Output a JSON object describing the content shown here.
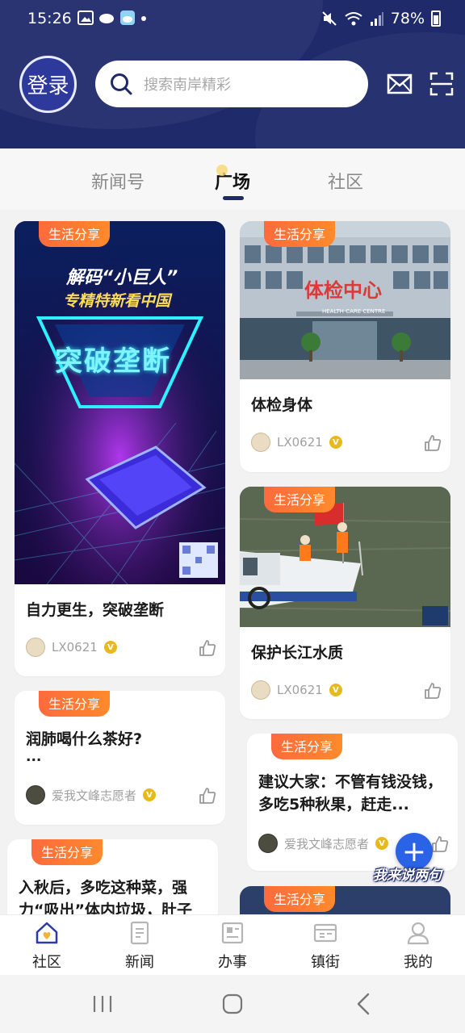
{
  "status_bar": {
    "time": "15:26",
    "battery": "78%"
  },
  "header": {
    "login_label": "登录",
    "search_placeholder": "搜索南岸精彩",
    "mail_icon": "mail-icon",
    "scan_icon": "scan-icon"
  },
  "tabs": [
    {
      "label": "新闻号",
      "active": false
    },
    {
      "label": "广场",
      "active": true
    },
    {
      "label": "社区",
      "active": false
    }
  ],
  "feed": {
    "cards": [
      {
        "tag": "生活分享",
        "title": "自力更生，突破垄断",
        "author": "LX0621",
        "image_text": [
          "解码“小巨人”",
          "专精特新看中国",
          "突破垄断"
        ]
      },
      {
        "tag": "生活分享",
        "title": "体检身体",
        "author": "LX0621",
        "image_text": [
          "体检中心",
          "HEALTH CARE CENTRE"
        ]
      },
      {
        "tag": "生活分享",
        "title": "保护长江水质",
        "author": "LX0621"
      },
      {
        "tag": "生活分享",
        "title": "润肺喝什么茶好?",
        "excerpt": "...",
        "author": "爱我文峰志愿者"
      },
      {
        "tag": "生活分享",
        "title": "建议大家：不管有钱没钱，多吃5种秋果，赶走...",
        "author": "爱我文峰志愿者"
      },
      {
        "tag": "生活分享",
        "title": "入秋后，多吃这种菜，强力“吸出”体内垃圾，肚子"
      },
      {
        "tag": "生活分享"
      }
    ]
  },
  "fab": {
    "symbol": "+",
    "label": "我来说两句"
  },
  "bottom_nav": [
    {
      "label": "社区",
      "icon": "home-icon",
      "active": true
    },
    {
      "label": "新闻",
      "icon": "news-icon",
      "active": false
    },
    {
      "label": "办事",
      "icon": "service-icon",
      "active": false
    },
    {
      "label": "镇街",
      "icon": "town-icon",
      "active": false
    },
    {
      "label": "我的",
      "icon": "user-icon",
      "active": false
    }
  ],
  "colors": {
    "header_bg": "#1f2a6b",
    "tag": "#ff6a3d",
    "accent": "#2b63e6",
    "badge": "#e7b91c"
  }
}
